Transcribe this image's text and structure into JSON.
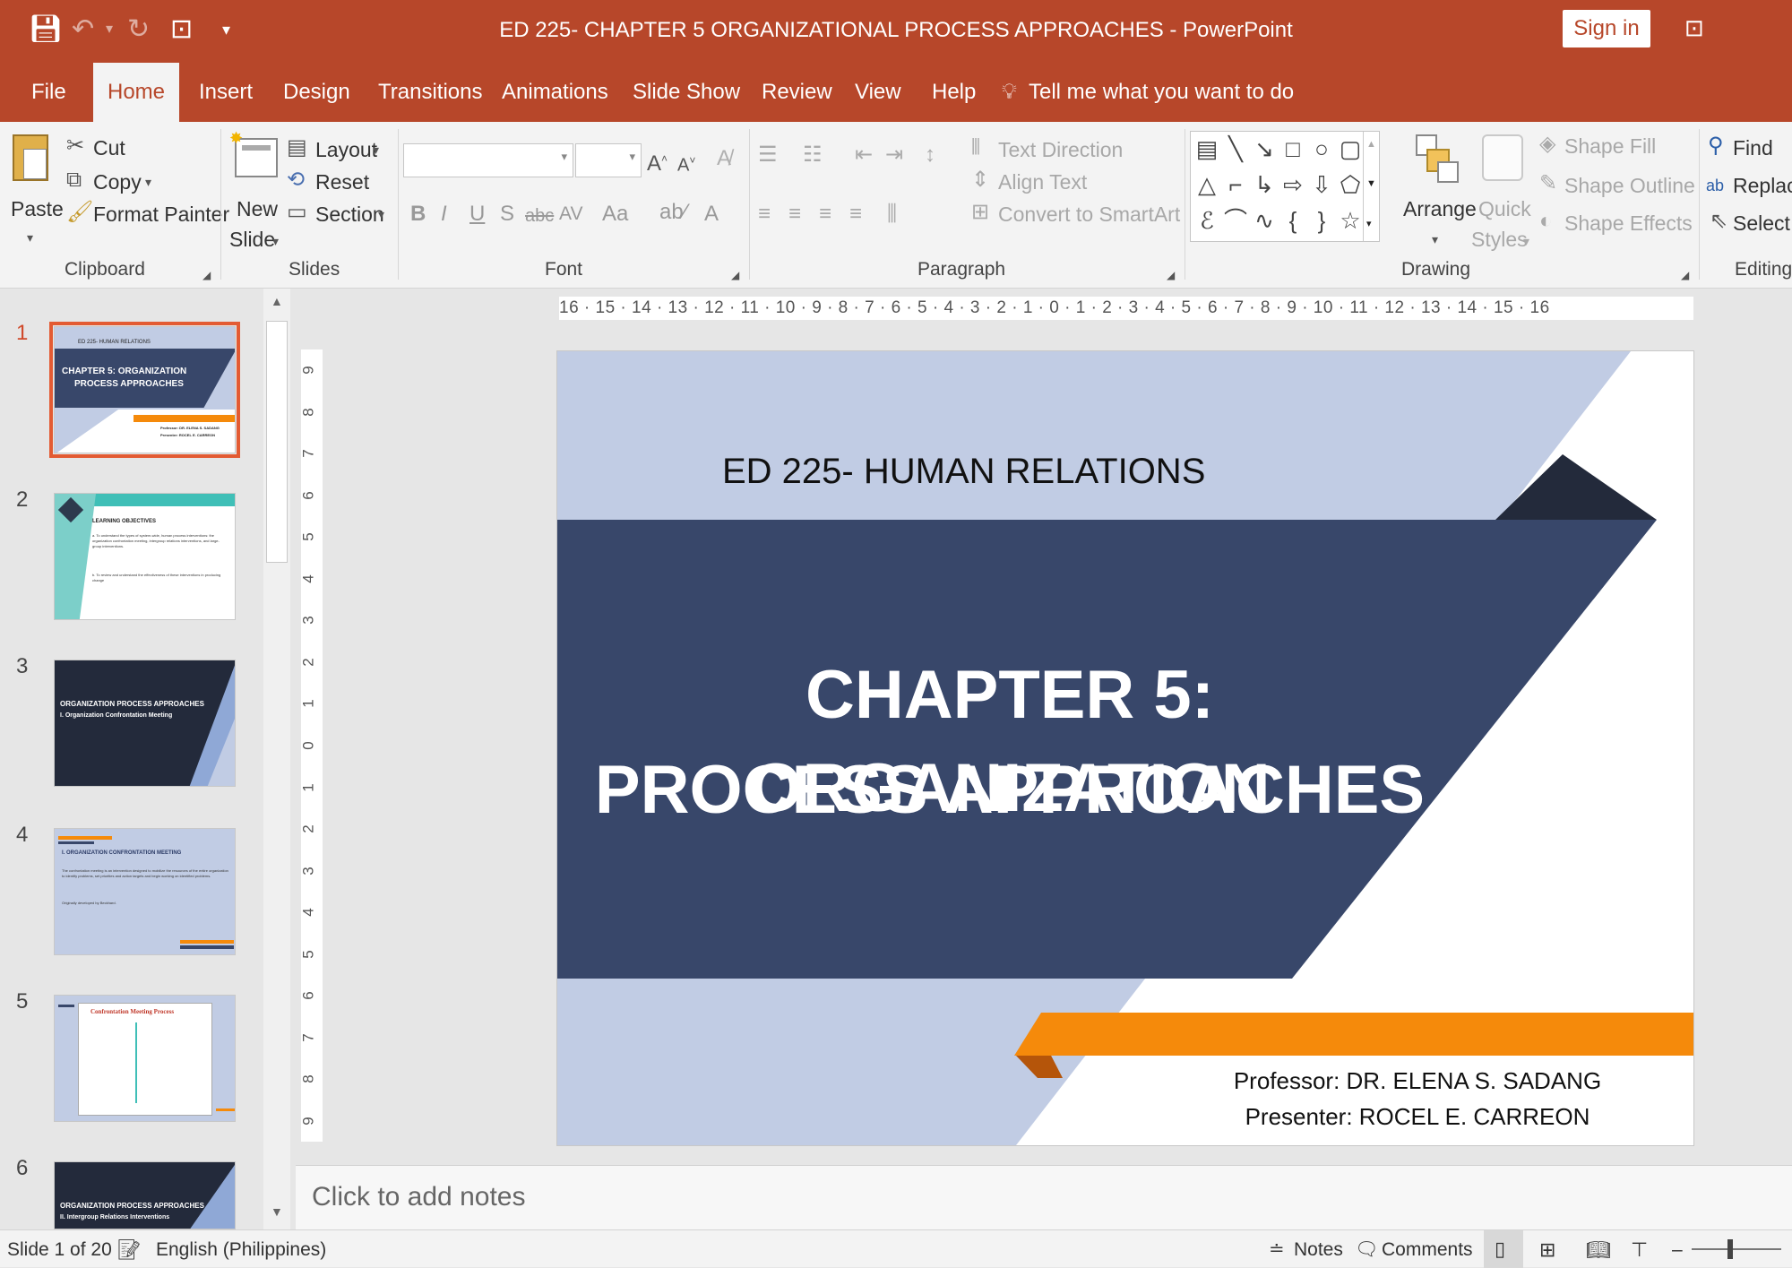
{
  "window": {
    "title": "ED 225- CHAPTER 5 ORGANIZATIONAL PROCESS APPROACHES  -  PowerPoint",
    "sign_in": "Sign in"
  },
  "tabs": [
    "File",
    "Home",
    "Insert",
    "Design",
    "Transitions",
    "Animations",
    "Slide Show",
    "Review",
    "View",
    "Help"
  ],
  "tell_me": "Tell me what you want to do",
  "ribbon": {
    "clipboard": {
      "paste": "Paste",
      "cut": "Cut",
      "copy": "Copy",
      "format_painter": "Format Painter",
      "label": "Clipboard"
    },
    "slides": {
      "new_slide_1": "New",
      "new_slide_2": "Slide",
      "layout": "Layout",
      "reset": "Reset",
      "section": "Section",
      "label": "Slides"
    },
    "font": {
      "label": "Font",
      "bold": "B",
      "italic": "I",
      "underline": "U",
      "shadow": "S",
      "strike": "abc",
      "spacing": "AV",
      "case": "Aa",
      "color": "A"
    },
    "paragraph": {
      "text_direction": "Text Direction",
      "align_text": "Align Text",
      "convert_smartart": "Convert to SmartArt",
      "label": "Paragraph"
    },
    "drawing": {
      "arrange": "Arrange",
      "quick_styles_1": "Quick",
      "quick_styles_2": "Styles",
      "shape_fill": "Shape Fill",
      "shape_outline": "Shape Outline",
      "shape_effects": "Shape Effects",
      "label": "Drawing"
    },
    "editing": {
      "find": "Find",
      "replace": "Replace",
      "select": "Select",
      "label": "Editing"
    }
  },
  "ruler": {
    "horizontal": "16 · 15 · 14 · 13 · 12 · 11 · 10 · 9 · 8 · 7 · 6 · 5 · 4 · 3 · 2 · 1 · 0 · 1 · 2 · 3 · 4 · 5 · 6 · 7 · 8 · 9 · 10 · 11 · 12 · 13 · 14 · 15 · 16",
    "vertical": [
      "9",
      "8",
      "7",
      "6",
      "5",
      "4",
      "3",
      "2",
      "1",
      "0",
      "1",
      "2",
      "3",
      "4",
      "5",
      "6",
      "7",
      "8",
      "9"
    ]
  },
  "thumbnails": [
    {
      "num": "1",
      "header": "ED 225- HUMAN RELATIONS",
      "title_1": "CHAPTER 5: ORGANIZATION",
      "title_2": "PROCESS APPROACHES",
      "foot_1": "Professor: DR. ELENA S. SADANG",
      "foot_2": "Presenter: ROCEL E. CARREON"
    },
    {
      "num": "2",
      "title": "LEARNING OBJECTIVES",
      "line_1": "a. To understand the types of system-wide, human process interventions: the organization confrontation meeting, intergroup relations interventions, and large-group interventions.",
      "line_2": "b. To review and understand the effectiveness of these interventions in producing change"
    },
    {
      "num": "3",
      "title_1": "ORGANIZATION PROCESS APPROACHES",
      "title_2": "I. Organization Confrontation Meeting"
    },
    {
      "num": "4",
      "title": "I. ORGANIZATION CONFRONTATION MEETING",
      "body": "The confrontation meeting is an intervention designed to mobilize the resources of the entire organization to identify problems, set priorities and action targets and begin working on identified problems.",
      "note": "Originally developed by Beckhard."
    },
    {
      "num": "5",
      "title": "Confrontation Meeting Process"
    },
    {
      "num": "6",
      "title_1": "ORGANIZATION PROCESS APPROACHES",
      "title_2": "II. Intergroup Relations Interventions"
    }
  ],
  "slide": {
    "header": "ED 225- HUMAN RELATIONS",
    "title_1": "CHAPTER 5: ORGANIZATION",
    "title_2": "PROCESS APPROACHES",
    "professor": "Professor: DR. ELENA S. SADANG",
    "presenter": "Presenter: ROCEL E. CARREON"
  },
  "notes_placeholder": "Click to add notes",
  "status": {
    "slide_counter": "Slide 1 of 20",
    "language": "English (Philippines)",
    "notes": "Notes",
    "comments": "Comments"
  },
  "colors": {
    "accent": "#b7472a",
    "slide_navy": "#38476a",
    "slide_light_blue": "#c1cce4",
    "slide_dark": "#232a3b",
    "slide_orange": "#f58a0b"
  }
}
